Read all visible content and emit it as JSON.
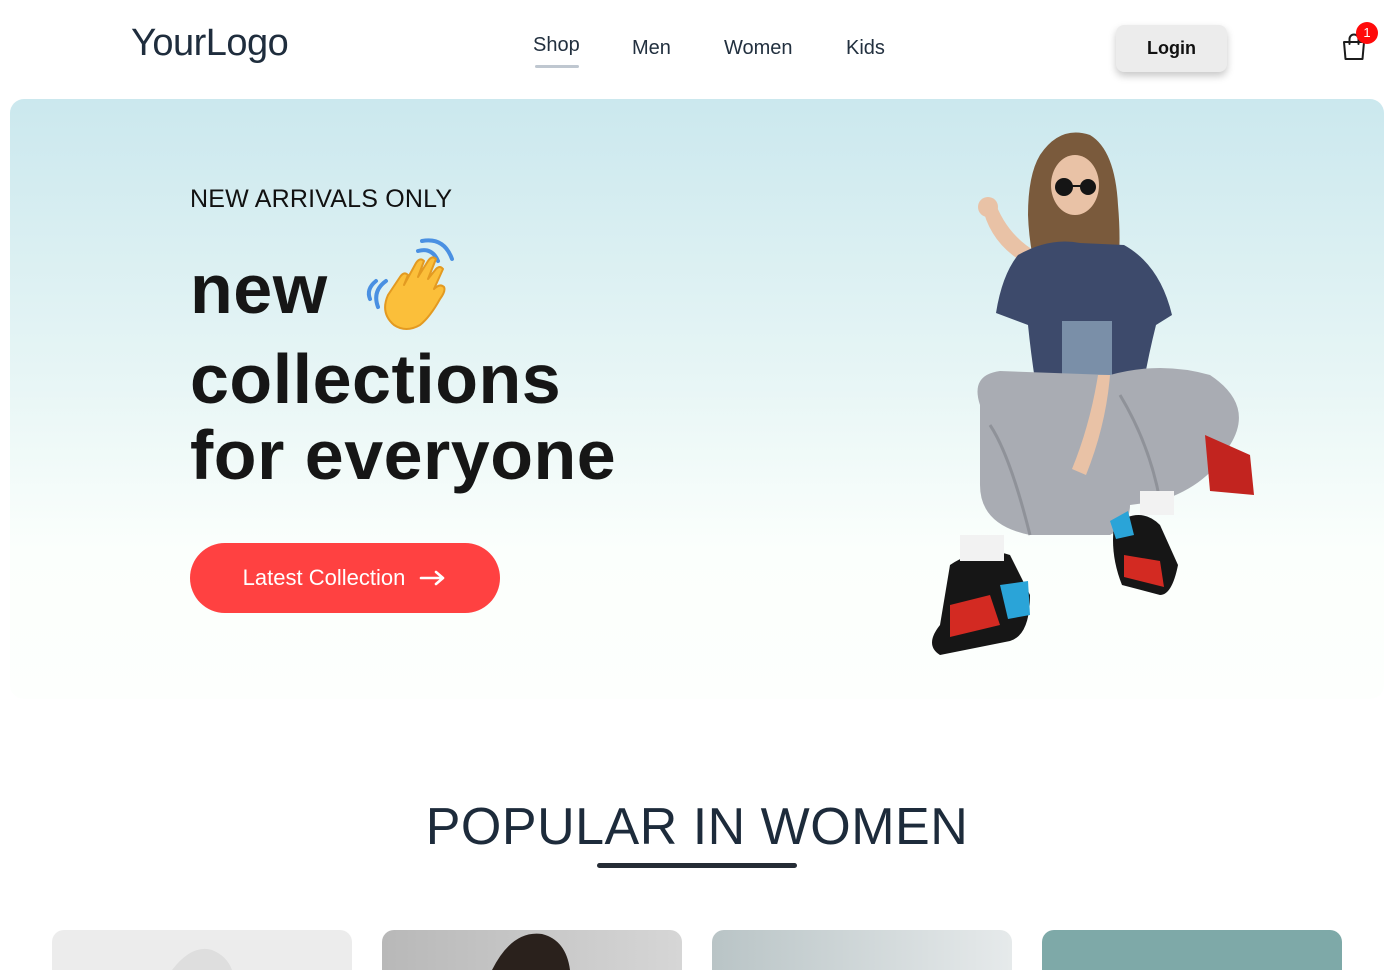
{
  "nav": {
    "logo": "YourLogo",
    "links": [
      {
        "label": "Shop",
        "active": true
      },
      {
        "label": "Men"
      },
      {
        "label": "Women"
      },
      {
        "label": "Kids"
      }
    ],
    "login_label": "Login",
    "cart_icon": "shopping-bag-icon",
    "cart_count": "1"
  },
  "hero": {
    "eyebrow": "NEW ARRIVALS ONLY",
    "line1": "new",
    "line2": "collections",
    "line3": "for everyone",
    "wave_icon": "waving-hand-icon",
    "cta_label": "Latest Collection",
    "cta_icon": "arrow-right-icon"
  },
  "popular": {
    "title": "POPULAR IN WOMEN"
  },
  "colors": {
    "accent": "#ff4141",
    "badge": "#ff0a0a",
    "heading": "#1d2b3b",
    "hero_top": "#cbe8ee",
    "hero_bottom": "#fdfffd"
  }
}
